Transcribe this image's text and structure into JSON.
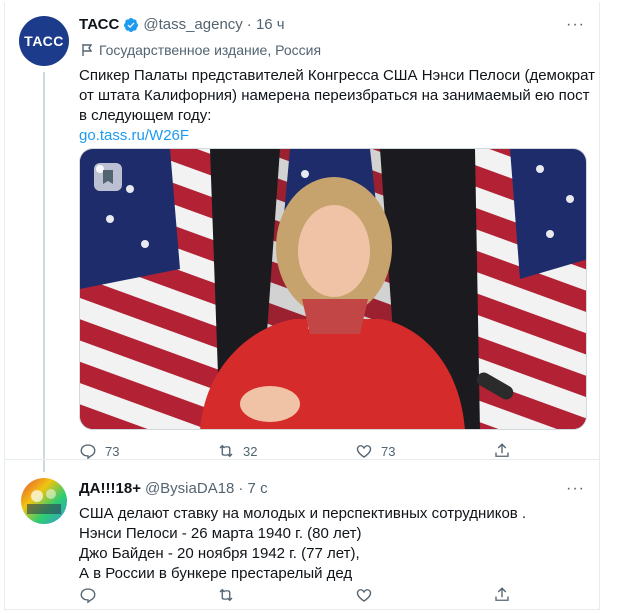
{
  "tweet1": {
    "name": "ТАСС",
    "handle": "@tass_agency",
    "time": "· 16 ч",
    "label": "Государственное издание, Россия",
    "text_lines": [
      "Спикер Палаты представителей Конгресса США Нэнси Пелоси (демократ",
      "от штата Калифорния) намерена переизбраться на занимаемый ею пост",
      "в следующем году:"
    ],
    "link": "go.tass.ru/W26F",
    "avatar_text": "ТАСС",
    "replies": "73",
    "retweets": "32",
    "likes": "73"
  },
  "tweet2": {
    "name": "ДА!!!18+",
    "handle": "@BysiaDA18",
    "time": "· 7 с",
    "text_lines": [
      "США делают ставку на молодых и перспективных сотрудников .",
      "Нэнси Пелоси -  26 марта 1940 г. (80 лет)",
      "Джо Байден -  20 ноября 1942 г. (77 лет),",
      "А в России в бункере престарелый дед"
    ]
  },
  "colors": {
    "accent": "#1d9bf0",
    "muted": "#536471",
    "tass_blue": "#1d3b8b"
  }
}
